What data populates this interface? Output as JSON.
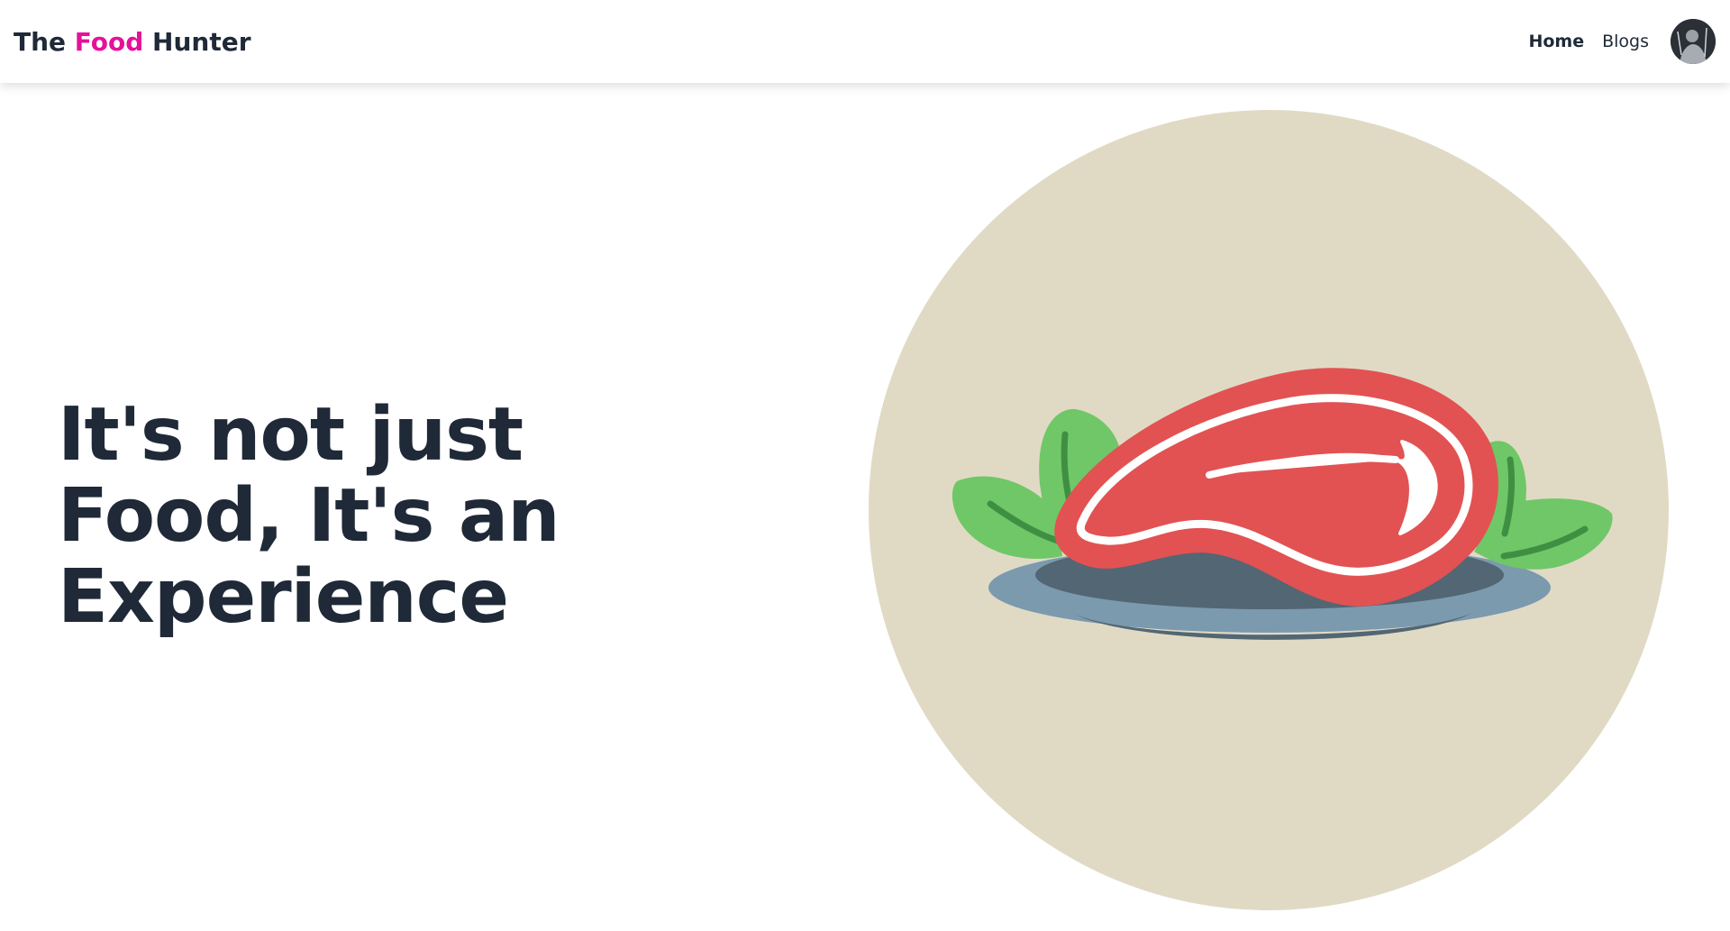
{
  "navbar": {
    "brand_pre": "The ",
    "brand_accent": "Food",
    "brand_post": " Hunter",
    "links": [
      {
        "label": "Home",
        "active": true
      },
      {
        "label": "Blogs",
        "active": false
      }
    ]
  },
  "hero": {
    "title_lines": [
      "It's not just",
      "Food, It's an",
      "Experience"
    ]
  },
  "colors": {
    "brand_accent": "#e5119b",
    "text_dark": "#1f2937",
    "circle_bg": "#e0dac5",
    "meat_red": "#e25252",
    "leaf_green": "#6fc767",
    "plate_blue": "#7b9aae"
  }
}
